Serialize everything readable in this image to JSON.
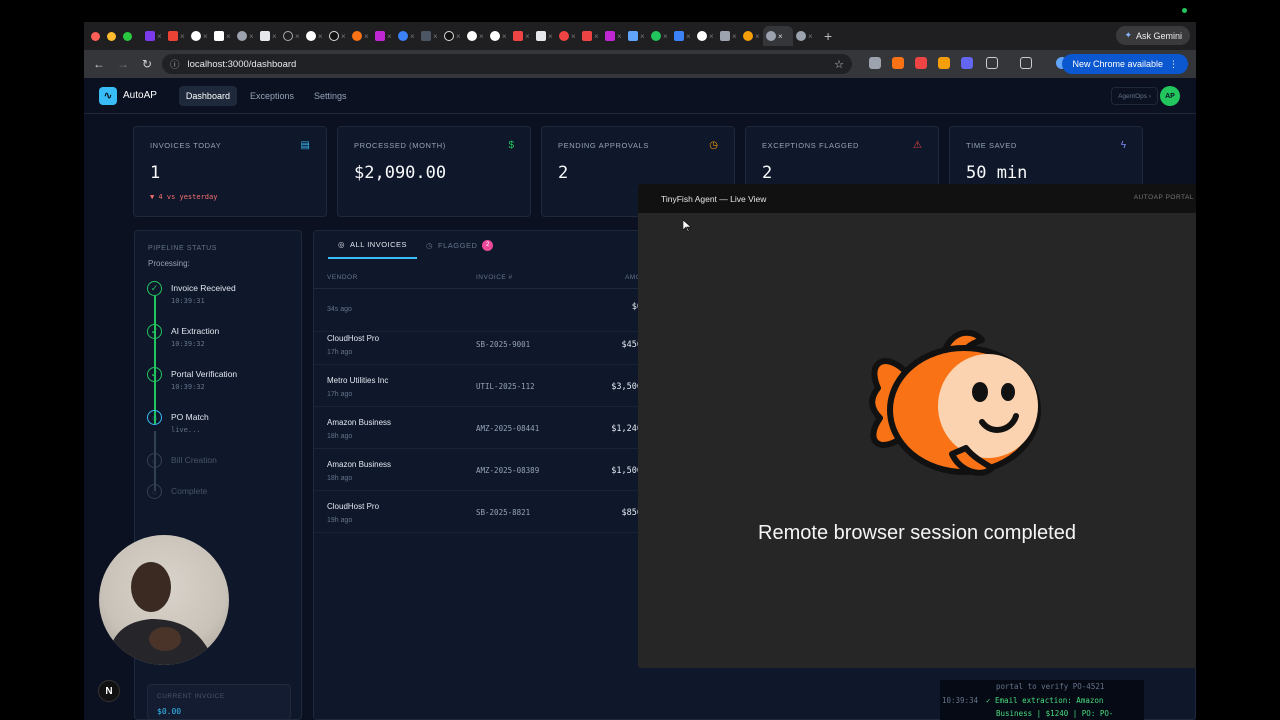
{
  "browser": {
    "ask_gemini": "Ask Gemini",
    "url": "localhost:3000/dashboard",
    "update_label": "New Chrome available"
  },
  "app": {
    "brand": "AutoAP",
    "nav": [
      "Dashboard",
      "Exceptions",
      "Settings"
    ],
    "agentops": "AgentOps",
    "avatar": "AP"
  },
  "cards": [
    {
      "label": "INVOICES TODAY",
      "value": "1",
      "sub": "▼ 4 vs yesterday",
      "icon": "document-icon",
      "icon_color": "#38bdf8"
    },
    {
      "label": "PROCESSED (MONTH)",
      "value": "$2,090.00",
      "icon": "dollar-icon",
      "icon_color": "#22c55e"
    },
    {
      "label": "PENDING APPROVALS",
      "value": "2",
      "icon": "clock-icon",
      "icon_color": "#f59e0b"
    },
    {
      "label": "EXCEPTIONS FLAGGED",
      "value": "2",
      "icon": "warning-icon",
      "icon_color": "#ef4444"
    },
    {
      "label": "TIME SAVED",
      "value": "50 min",
      "icon": "bolt-icon",
      "icon_color": "#818cf8"
    }
  ],
  "pipeline": {
    "title": "PIPELINE STATUS",
    "status": "Processing:",
    "steps": [
      {
        "name": "Invoice Received",
        "time": "10:39:31",
        "state": "done"
      },
      {
        "name": "AI Extraction",
        "time": "10:39:32",
        "state": "done"
      },
      {
        "name": "Portal Verification",
        "time": "10:39:32",
        "state": "done"
      },
      {
        "name": "PO Match",
        "time": "live...",
        "state": "current"
      },
      {
        "name": "Bill Creation",
        "time": "",
        "state": "pending"
      },
      {
        "name": "Complete",
        "time": "",
        "state": "pending"
      }
    ],
    "current_invoice_label": "CURRENT INVOICE",
    "current_invoice_value": "$0.00"
  },
  "invoices": {
    "tabs": {
      "all": "ALL INVOICES",
      "flagged": "FLAGGED",
      "flagged_count": "2"
    },
    "columns": [
      "VENDOR",
      "INVOICE #",
      "AMO"
    ],
    "rows": [
      {
        "vendor": "",
        "ago": "34s ago",
        "number": "",
        "amount": "$0"
      },
      {
        "vendor": "CloudHost Pro",
        "ago": "17h ago",
        "number": "SB-2025-9001",
        "amount": "$450"
      },
      {
        "vendor": "Metro Utilities Inc",
        "ago": "17h ago",
        "number": "UTIL-2025-112",
        "amount": "$3,500"
      },
      {
        "vendor": "Amazon Business",
        "ago": "18h ago",
        "number": "AMZ-2025-08441",
        "amount": "$1,240"
      },
      {
        "vendor": "Amazon Business",
        "ago": "18h ago",
        "number": "AMZ-2025-08389",
        "amount": "$1,500"
      },
      {
        "vendor": "CloudHost Pro",
        "ago": "19h ago",
        "number": "SB-2025-8821",
        "amount": "$850"
      }
    ]
  },
  "log": {
    "line1": "portal to verify PO-4521",
    "line2_time": "10:39:34",
    "line2_text": "✓ Email extraction: Amazon",
    "line3": "Business | $1240 | PO: PO-"
  },
  "live_view": {
    "title": "TinyFish Agent — Live View",
    "tag": "AUTOAP PORTAL",
    "message": "Remote browser session completed"
  },
  "next_badge": "N"
}
